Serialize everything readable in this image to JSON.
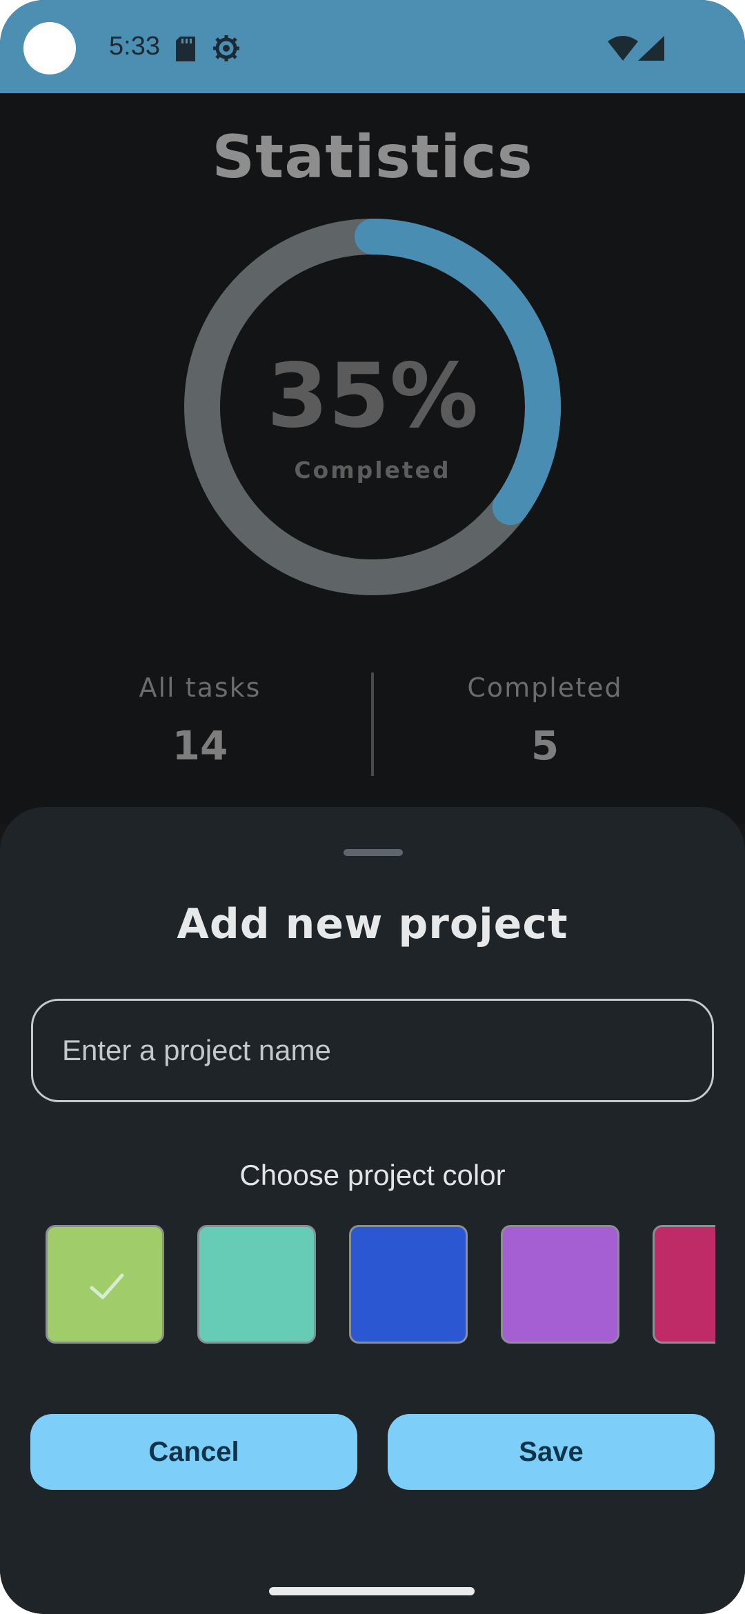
{
  "status_bar": {
    "time": "5:33",
    "icons": [
      "sd-card-icon",
      "gear-icon",
      "wifi-icon",
      "signal-icon"
    ],
    "background_color": "#4d8fb3"
  },
  "statistics": {
    "title": "Statistics",
    "percent_label": "35%",
    "progress": 0.35,
    "completed_caption": "Completed",
    "progress_color": "#4a8db3",
    "track_color": "#5f6466",
    "all_tasks_label": "All tasks",
    "all_tasks_value": "14",
    "completed_label": "Completed",
    "completed_value": "5"
  },
  "sheet": {
    "title": "Add new project",
    "input": {
      "placeholder": "Enter a project name",
      "value": ""
    },
    "color_label": "Choose project color",
    "colors": [
      {
        "hex": "#a0cd6a",
        "selected": true
      },
      {
        "hex": "#66ccb5",
        "selected": false
      },
      {
        "hex": "#2c57d3",
        "selected": false
      },
      {
        "hex": "#a65fd3",
        "selected": false
      },
      {
        "hex": "#bf2b67",
        "selected": false
      }
    ],
    "cancel_label": "Cancel",
    "save_label": "Save"
  }
}
